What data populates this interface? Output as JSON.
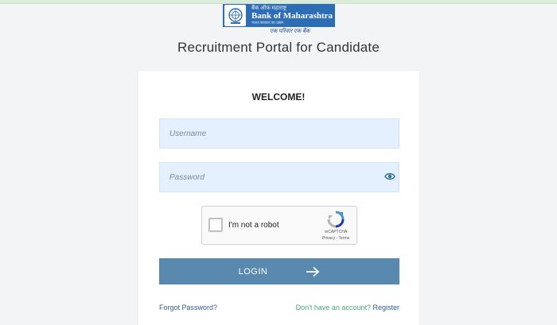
{
  "header": {
    "logo": {
      "hindi_name": "बैंक ऑफ महाराष्ट्र",
      "english_name": "Bank of Maharashtra",
      "tagline": "भारत सरकार का उद्यम",
      "slogan": "एक परिवार एक बैंक"
    },
    "title": "Recruitment Portal for Candidate"
  },
  "login_card": {
    "heading": "WELCOME!",
    "username": {
      "value": "",
      "placeholder": "Username"
    },
    "password": {
      "value": "",
      "placeholder": "Password",
      "toggle_icon": "eye-icon"
    },
    "captcha": {
      "label": "I'm not a robot",
      "brand": "reCAPTCHA",
      "links": "Privacy - Terms",
      "checked": false
    },
    "login_button": {
      "label": "LOGIN",
      "icon": "arrow-right-icon"
    },
    "forgot_link": "Forgot Password?",
    "register_prompt": "Don't have an account?",
    "register_link": "Register"
  },
  "colors": {
    "brand_blue": "#2c6db5",
    "login_button": "#5a89b0",
    "input_bg": "#e4f0fd",
    "link": "#2f5f93",
    "prompt_green": "#4aa37a"
  }
}
